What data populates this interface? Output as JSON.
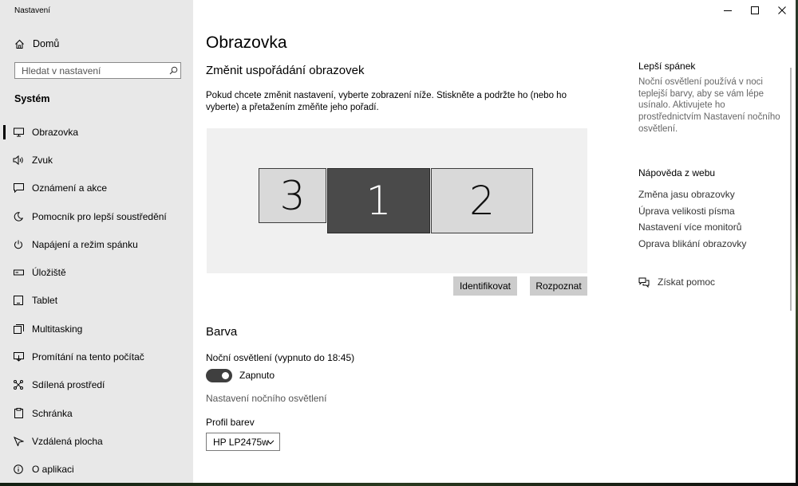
{
  "window": {
    "app_title": "Nastavení"
  },
  "sidebar": {
    "home_label": "Domů",
    "search_placeholder": "Hledat v nastavení",
    "section_title": "Systém",
    "items": [
      {
        "label": "Obrazovka",
        "icon": "monitor-icon",
        "active": true
      },
      {
        "label": "Zvuk",
        "icon": "speaker-icon"
      },
      {
        "label": "Oznámení a akce",
        "icon": "notification-icon"
      },
      {
        "label": "Pomocník pro lepší soustředění",
        "icon": "moon-icon"
      },
      {
        "label": "Napájení a režim spánku",
        "icon": "power-icon"
      },
      {
        "label": "Úložiště",
        "icon": "storage-icon"
      },
      {
        "label": "Tablet",
        "icon": "tablet-icon"
      },
      {
        "label": "Multitasking",
        "icon": "multitasking-icon"
      },
      {
        "label": "Promítání na tento počítač",
        "icon": "projecting-icon"
      },
      {
        "label": "Sdílená prostředí",
        "icon": "shared-icon"
      },
      {
        "label": "Schránka",
        "icon": "clipboard-icon"
      },
      {
        "label": "Vzdálená plocha",
        "icon": "remote-desktop-icon"
      },
      {
        "label": "O aplikaci",
        "icon": "info-icon"
      }
    ]
  },
  "main": {
    "page_title": "Obrazovka",
    "arrange_title": "Změnit uspořádání obrazovek",
    "arrange_desc": "Pokud chcete změnit nastavení, vyberte zobrazení níže. Stiskněte a podržte ho (nebo ho vyberte) a přetažením změňte jeho pořadí.",
    "monitors": [
      {
        "label": "3",
        "selected": false
      },
      {
        "label": "1",
        "selected": true
      },
      {
        "label": "2",
        "selected": false
      }
    ],
    "identify_button": "Identifikovat",
    "detect_button": "Rozpoznat",
    "color_title": "Barva",
    "night_light_label": "Noční osvětlení (vypnuto do 18:45)",
    "toggle_label": "Zapnuto",
    "toggle_on": true,
    "night_light_link": "Nastavení nočního osvětlení",
    "profile_label": "Profil barev",
    "profile_value": "HP LP2475w"
  },
  "right_panel": {
    "sleep_title": "Lepší spánek",
    "sleep_text": "Noční osvětlení používá v noci teplejší barvy, aby se vám lépe usínalo. Aktivujete ho prostřednictvím Nastavení nočního osvětlení.",
    "web_help_title": "Nápověda z webu",
    "links": [
      "Změna jasu obrazovky",
      "Úprava velikosti písma",
      "Nastavení více monitorů",
      "Oprava blikání obrazovky"
    ],
    "get_help": "Získat pomoc"
  },
  "colors": {
    "selected_monitor": "#4a4a4a",
    "monitor": "#d9d9d9",
    "sidebar_bg": "#e8e8e8",
    "button_bg": "#cccccc"
  }
}
